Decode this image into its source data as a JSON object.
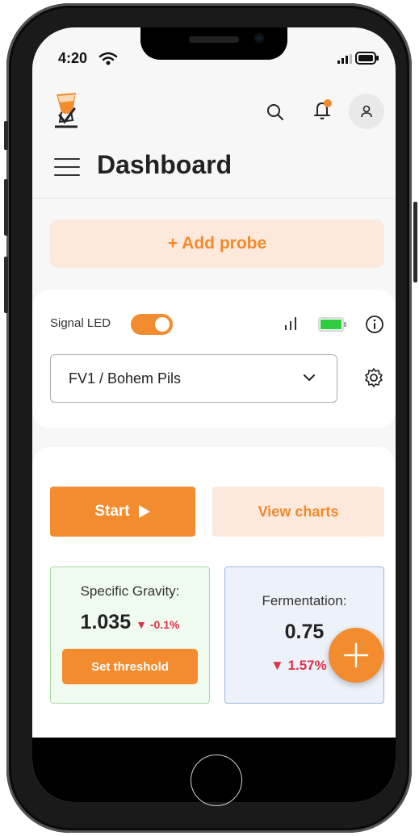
{
  "status_bar": {
    "time": "4:20"
  },
  "header": {
    "title": "Dashboard"
  },
  "add_probe": {
    "label": "+ Add probe"
  },
  "probe": {
    "signal_led_label": "Signal LED",
    "signal_led_on": true,
    "selected": "FV1 / Bohem Pils"
  },
  "actions": {
    "start_label": "Start",
    "charts_label": "View charts"
  },
  "gravity": {
    "label": "Specific Gravity:",
    "value": "1.035",
    "delta": "▼ -0.1%",
    "button_label": "Set threshold"
  },
  "fermentation": {
    "label": "Fermentation:",
    "value": "0.75",
    "delta": "▼ 1.57%"
  },
  "colors": {
    "accent": "#f28c2e",
    "accent_light": "#fde9dc",
    "negative": "#e0314a",
    "battery": "#2ecc40"
  }
}
